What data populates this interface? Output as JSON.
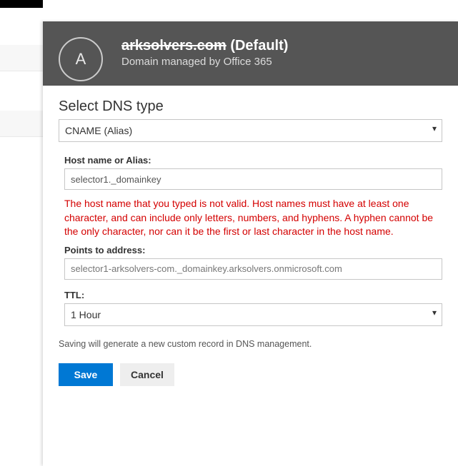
{
  "header": {
    "avatar_letter": "A",
    "domain_name": "arksolvers.com",
    "default_suffix": " (Default)",
    "subtitle": "Domain managed by Office 365"
  },
  "form": {
    "section_title": "Select DNS type",
    "dns_type_value": "CNAME (Alias)",
    "host_label": "Host name or Alias:",
    "host_value": "selector1._domainkey",
    "host_error": "The host name that you typed is not valid. Host names must have at least one character, and can include only letters, numbers, and hyphens. A hyphen cannot be the only character, nor can it be the first or last character in the host name.",
    "points_label": "Points to address:",
    "points_value": "selector1-arksolvers-com._domainkey.arksolvers.onmicrosoft.com",
    "ttl_label": "TTL:",
    "ttl_value": "1 Hour",
    "save_note": "Saving will generate a new custom record in DNS management."
  },
  "buttons": {
    "save": "Save",
    "cancel": "Cancel"
  }
}
